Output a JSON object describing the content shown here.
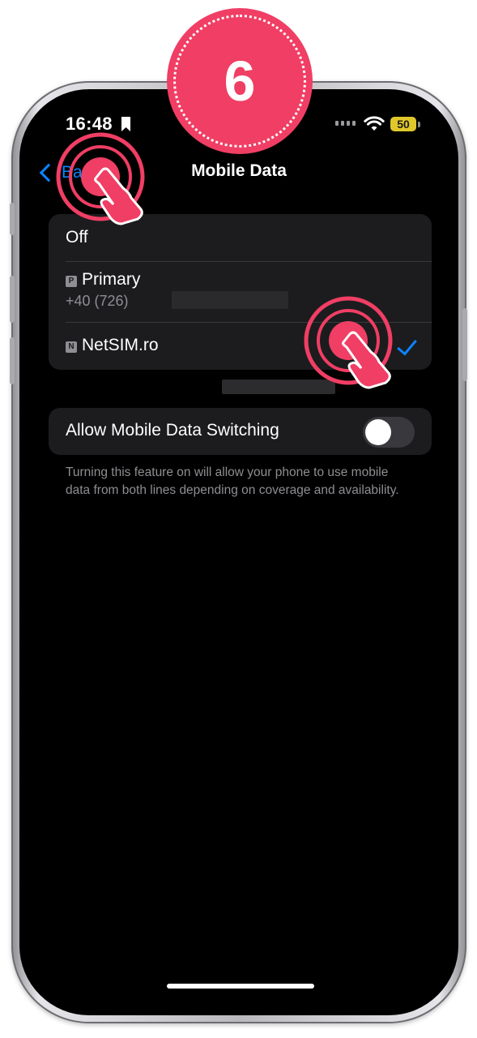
{
  "step_badge": {
    "number": "6"
  },
  "status_bar": {
    "time": "16:48",
    "battery": "50"
  },
  "nav": {
    "back_label": "Back",
    "title": "Mobile Data"
  },
  "options": {
    "off_label": "Off",
    "primary": {
      "badge": "P",
      "label": "Primary",
      "phone_number": "+40 (726) "
    },
    "netsim": {
      "badge": "N",
      "label": "NetSIM.ro",
      "selected": true
    }
  },
  "switching": {
    "label": "Allow Mobile Data Switching",
    "enabled": false,
    "footnote": "Turning this feature on will allow your phone to use mobile data from both lines depending on coverage and availability."
  },
  "colors": {
    "accent": "#0a84ff",
    "annotation": "#f03e64",
    "background": "#000000",
    "cell": "#1c1c1e"
  }
}
